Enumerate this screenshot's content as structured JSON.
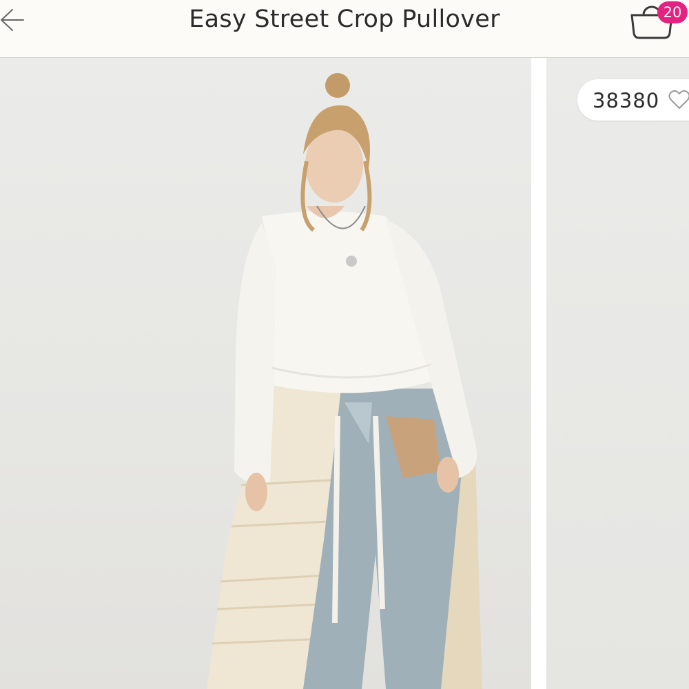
{
  "header": {
    "title": "Easy Street Crop Pullover",
    "back_icon": "back-arrow-icon",
    "bag_icon": "shopping-bag-icon",
    "bag_count": "20",
    "accent_color": "#e4227f"
  },
  "gallery": {
    "likes_count": "38380",
    "like_icon": "heart-outline-icon",
    "images": [
      {
        "alt": "Model wearing cream cropped pullover with jeans and lace skirt"
      },
      {
        "alt": "Next product image"
      }
    ]
  }
}
